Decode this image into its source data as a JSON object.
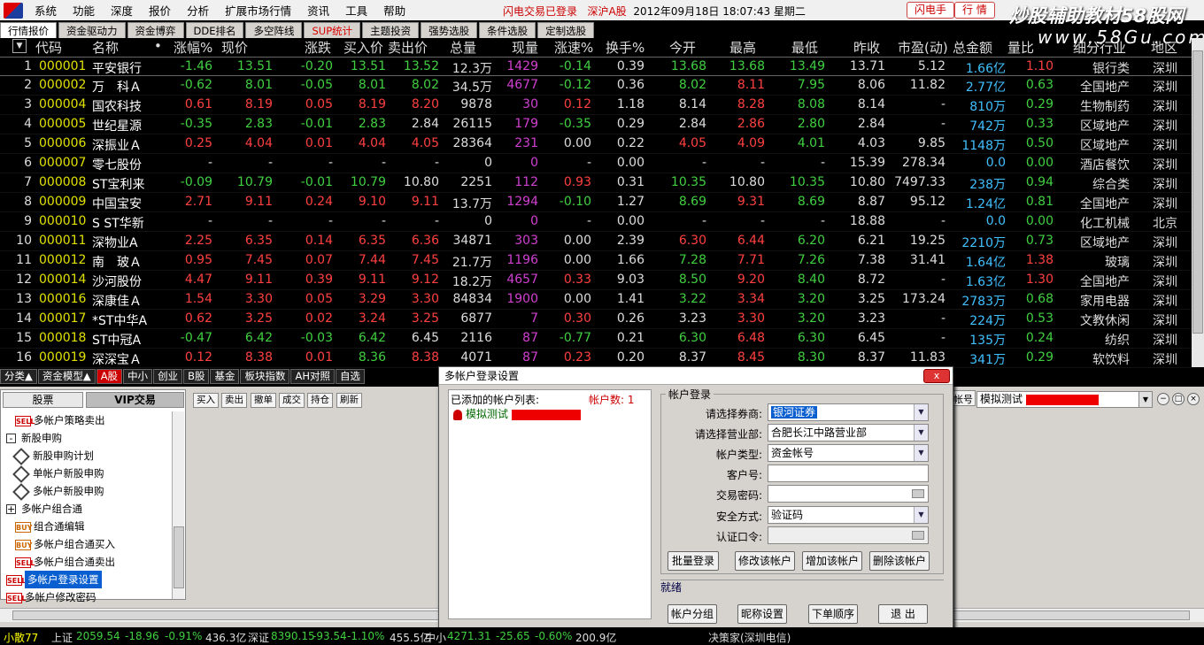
{
  "menu": [
    "系统",
    "功能",
    "深度",
    "报价",
    "分析",
    "扩展市场行情",
    "资讯",
    "工具",
    "帮助"
  ],
  "status": {
    "login": "闪电交易已登录",
    "market": "深沪A股",
    "datetime": "2012年09月18日 18:07:43 星期二"
  },
  "buttons": {
    "flash": "闪电手",
    "quote": "行 情"
  },
  "watermark": {
    "line1": "炒股辅助教材58股网",
    "line2": "www.58Gu.com"
  },
  "tabs": [
    "行情报价",
    "资金驱动力",
    "资金博弈",
    "DDE排名",
    "多空阵线",
    "SUP统计",
    "主题投资",
    "强势选股",
    "条件选股",
    "定制选股"
  ],
  "table": {
    "headers": [
      "代码",
      "名称",
      "•",
      "涨幅%",
      "现价",
      "涨跌",
      "买入价",
      "卖出价",
      "总量",
      "现量",
      "涨速%",
      "换手%",
      "今开",
      "最高",
      "最低",
      "昨收",
      "市盈(动)",
      "总金额",
      "量比",
      "细分行业",
      "地区"
    ],
    "rows": [
      [
        "1",
        "000001",
        "平安银行",
        "-1.46",
        "13.51",
        "-0.20",
        "13.51",
        "13.52",
        "12.3万",
        "1429",
        "-0.14",
        "0.39",
        "13.68",
        "13.68",
        "13.49",
        "13.71",
        "5.12",
        "1.66亿",
        "1.10",
        "银行类",
        "深圳"
      ],
      [
        "2",
        "000002",
        "万　科Ａ",
        "-0.62",
        "8.01",
        "-0.05",
        "8.01",
        "8.02",
        "34.5万",
        "4677",
        "-0.12",
        "0.36",
        "8.02",
        "8.11",
        "7.95",
        "8.06",
        "11.82",
        "2.77亿",
        "0.63",
        "全国地产",
        "深圳"
      ],
      [
        "3",
        "000004",
        "国农科技",
        "0.61",
        "8.19",
        "0.05",
        "8.19",
        "8.20",
        "9878",
        "30",
        "0.12",
        "1.18",
        "8.14",
        "8.28",
        "8.08",
        "8.14",
        "-",
        "810万",
        "0.29",
        "生物制药",
        "深圳"
      ],
      [
        "4",
        "000005",
        "世纪星源",
        "-0.35",
        "2.83",
        "-0.01",
        "2.83",
        "2.84",
        "26115",
        "179",
        "-0.35",
        "0.29",
        "2.84",
        "2.86",
        "2.80",
        "2.84",
        "-",
        "742万",
        "0.33",
        "区域地产",
        "深圳"
      ],
      [
        "5",
        "000006",
        "深振业Ａ",
        "0.25",
        "4.04",
        "0.01",
        "4.04",
        "4.05",
        "28364",
        "231",
        "0.00",
        "0.22",
        "4.05",
        "4.09",
        "4.01",
        "4.03",
        "9.85",
        "1148万",
        "0.50",
        "区域地产",
        "深圳"
      ],
      [
        "6",
        "000007",
        "零七股份",
        "-",
        "-",
        "-",
        "-",
        "-",
        "0",
        "0",
        "-",
        "0.00",
        "-",
        "-",
        "-",
        "15.39",
        "278.34",
        "0.0",
        "0.00",
        "酒店餐饮",
        "深圳"
      ],
      [
        "7",
        "000008",
        "ST宝利来",
        "-0.09",
        "10.79",
        "-0.01",
        "10.79",
        "10.80",
        "2251",
        "112",
        "0.93",
        "0.31",
        "10.35",
        "10.80",
        "10.35",
        "10.80",
        "7497.33",
        "238万",
        "0.94",
        "综合类",
        "深圳"
      ],
      [
        "8",
        "000009",
        "中国宝安",
        "2.71",
        "9.11",
        "0.24",
        "9.10",
        "9.11",
        "13.7万",
        "1294",
        "-0.10",
        "1.27",
        "8.69",
        "9.31",
        "8.69",
        "8.87",
        "95.12",
        "1.24亿",
        "0.81",
        "全国地产",
        "深圳"
      ],
      [
        "9",
        "000010",
        "S ST华新",
        "-",
        "-",
        "-",
        "-",
        "-",
        "0",
        "0",
        "-",
        "0.00",
        "-",
        "-",
        "-",
        "18.88",
        "-",
        "0.0",
        "0.00",
        "化工机械",
        "北京"
      ],
      [
        "10",
        "000011",
        "深物业A",
        "2.25",
        "6.35",
        "0.14",
        "6.35",
        "6.36",
        "34871",
        "303",
        "0.00",
        "2.39",
        "6.30",
        "6.44",
        "6.20",
        "6.21",
        "19.25",
        "2210万",
        "0.73",
        "区域地产",
        "深圳"
      ],
      [
        "11",
        "000012",
        "南　玻Ａ",
        "0.95",
        "7.45",
        "0.07",
        "7.44",
        "7.45",
        "21.7万",
        "1196",
        "0.00",
        "1.66",
        "7.28",
        "7.71",
        "7.26",
        "7.38",
        "31.41",
        "1.64亿",
        "1.38",
        "玻璃",
        "深圳"
      ],
      [
        "12",
        "000014",
        "沙河股份",
        "4.47",
        "9.11",
        "0.39",
        "9.11",
        "9.12",
        "18.2万",
        "4657",
        "0.33",
        "9.03",
        "8.50",
        "9.20",
        "8.40",
        "8.72",
        "-",
        "1.63亿",
        "1.30",
        "全国地产",
        "深圳"
      ],
      [
        "13",
        "000016",
        "深康佳Ａ",
        "1.54",
        "3.30",
        "0.05",
        "3.29",
        "3.30",
        "84834",
        "1900",
        "0.00",
        "1.41",
        "3.22",
        "3.34",
        "3.20",
        "3.25",
        "173.24",
        "2783万",
        "0.68",
        "家用电器",
        "深圳"
      ],
      [
        "14",
        "000017",
        "*ST中华A",
        "0.62",
        "3.25",
        "0.02",
        "3.24",
        "3.25",
        "6877",
        "7",
        "0.30",
        "0.26",
        "3.23",
        "3.30",
        "3.20",
        "3.23",
        "-",
        "224万",
        "0.53",
        "文教休闲",
        "深圳"
      ],
      [
        "15",
        "000018",
        "ST中冠A",
        "-0.47",
        "6.42",
        "-0.03",
        "6.42",
        "6.45",
        "2116",
        "87",
        "-0.77",
        "0.21",
        "6.30",
        "6.48",
        "6.30",
        "6.45",
        "-",
        "135万",
        "0.24",
        "纺织",
        "深圳"
      ],
      [
        "16",
        "000019",
        "深深宝Ａ",
        "0.12",
        "8.38",
        "0.01",
        "8.36",
        "8.38",
        "4071",
        "87",
        "0.23",
        "0.20",
        "8.37",
        "8.45",
        "8.30",
        "8.37",
        "11.83",
        "341万",
        "0.29",
        "软饮料",
        "深圳"
      ]
    ]
  },
  "bottom_tabs": [
    "分类▲",
    "资金模型▲",
    "A股",
    "中小",
    "创业",
    "B股",
    "基金",
    "板块指数",
    "AH对照",
    "自选"
  ],
  "left_panel": {
    "tabs": [
      "股票",
      "VIP交易"
    ],
    "tree": [
      {
        "label": "多帐户策略卖出",
        "icon": "SELL",
        "kind": "sell",
        "indent": 1
      },
      {
        "label": "新股申购",
        "icon": "-",
        "kind": "expand",
        "indent": 0
      },
      {
        "label": "新股申购计划",
        "icon": "diamond",
        "kind": "dia",
        "indent": 1
      },
      {
        "label": "单帐户新股申购",
        "icon": "diamond",
        "kind": "dia",
        "indent": 1
      },
      {
        "label": "多帐户新股申购",
        "icon": "diamond",
        "kind": "dia",
        "indent": 1
      },
      {
        "label": "多帐户组合通",
        "icon": "+",
        "kind": "expand",
        "indent": 0
      },
      {
        "label": "组合通编辑",
        "icon": "BUY",
        "kind": "buy",
        "indent": 1
      },
      {
        "label": "多帐户组合通买入",
        "icon": "BUY",
        "kind": "buy",
        "indent": 1
      },
      {
        "label": "多帐户组合通卖出",
        "icon": "SELL",
        "kind": "sell",
        "indent": 1
      },
      {
        "label": "多帐户登录设置",
        "icon": "SELL",
        "kind": "sell",
        "indent": 0,
        "selected": true
      },
      {
        "label": "多帐户修改密码",
        "icon": "SELL",
        "kind": "sell",
        "indent": 0
      }
    ]
  },
  "toolbar": [
    "买入",
    "卖出",
    "撤单",
    "成交",
    "持仓",
    "刷新"
  ],
  "trade_right": {
    "label": "帐号",
    "account": "模拟测试"
  },
  "dialog": {
    "title": "多帐户登录设置",
    "close": "x",
    "list_header": "已添加的帐户列表:",
    "count_label": "帐户数: 1",
    "account": "模拟测试",
    "group_title": "帐户登录",
    "fields": {
      "broker_label": "请选择券商:",
      "broker_value": "银河证券",
      "branch_label": "请选择营业部:",
      "branch_value": "合肥长江中路营业部",
      "type_label": "帐户类型:",
      "type_value": "资金帐号",
      "client_label": "客户号:",
      "client_value": "",
      "password_label": "交易密码:",
      "security_label": "安全方式:",
      "security_value": "验证码",
      "auth_label": "认证口令:"
    },
    "btn_batch": "批量登录",
    "btn_modify": "修改该帐户",
    "btn_add": "增加该帐户",
    "btn_delete": "删除该帐户",
    "status": "就绪",
    "btn_group": "帐户分组",
    "btn_nick": "昵称设置",
    "btn_order": "下单顺序",
    "btn_exit": "退 出"
  },
  "bottom_bar": {
    "item1": "小散77",
    "sh": "上证",
    "sh_idx": "2059.54",
    "sh_chg": "-18.96",
    "sh_pct": "-0.91%",
    "sh_amt": "436.3亿",
    "sz": "深证",
    "sz_idx": "8390.15",
    "sz_chg": "-93.54",
    "sz_pct": "-1.10%",
    "sz_amt": "455.5亿",
    "zx": "中小",
    "zx_idx": "4271.31",
    "zx_chg": "-25.65",
    "zx_pct": "-0.60%",
    "zx_amt": "200.9亿",
    "right": "决策家(深圳电信)"
  },
  "colors": {
    "up": "#ff4040",
    "down": "#40d040",
    "code": "#e0e000",
    "name": "#ffffff",
    "vol": "#d040d0",
    "amt": "#40c0ff"
  }
}
